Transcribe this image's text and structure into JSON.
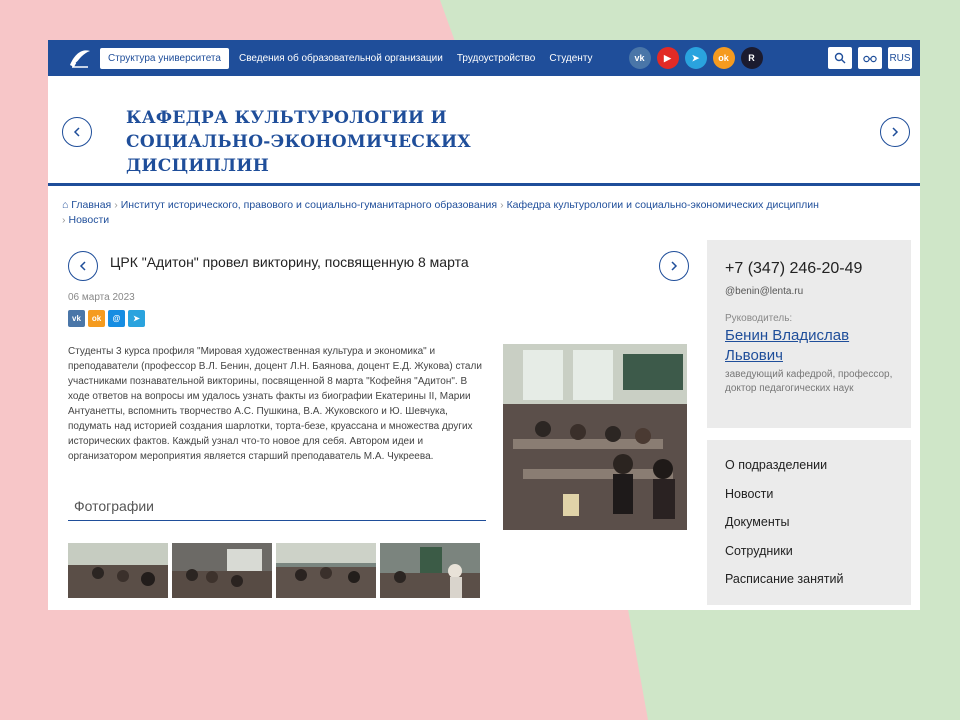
{
  "topbar": {
    "structure_label": "Структура университета",
    "nav": [
      "Сведения об образовательной организации",
      "Трудоустройство",
      "Студенту"
    ],
    "socials": [
      {
        "name": "vk",
        "label": "vk",
        "color": "#4a76a8"
      },
      {
        "name": "youtube",
        "label": "▶",
        "color": "#e22b26"
      },
      {
        "name": "telegram",
        "label": "➤",
        "color": "#2aa3de"
      },
      {
        "name": "odnoklassniki",
        "label": "ok",
        "color": "#f59b1f"
      },
      {
        "name": "rutube",
        "label": "R",
        "color": "#1b1b2f"
      }
    ],
    "lang": "RUS"
  },
  "header": {
    "title": "КАФЕДРА КУЛЬТУРОЛОГИИ И СОЦИАЛЬНО-ЭКОНОМИЧЕСКИХ ДИСЦИПЛИН"
  },
  "breadcrumb": [
    "Главная",
    "Институт исторического, правового и социально-гуманитарного образования",
    "Кафедра культурологии и социально-экономических дисциплин",
    "Новости"
  ],
  "article": {
    "title": "ЦРК \"Адитон\" провел викторину, посвященную 8 марта",
    "date": "06 марта 2023",
    "body": "Студенты 3 курса профиля \"Мировая художественная культура и экономика\" и преподаватели (профессор В.Л. Бенин, доцент Л.Н. Баянова, доцент Е.Д. Жукова) стали участниками познавательной викторины, посвященной 8 марта \"Кофейня \"Адитон\". В ходе ответов на вопросы им удалось узнать факты из биографии Екатерины II, Марии Антуанетты, вспомнить творчество А.С. Пушкина, В.А. Жуковского и Ю. Шевчука, подумать над историей создания шарлотки, торта-безе, круассана и множества других исторических фактов. Каждый узнал что-то новое для себя. Автором идеи и организатором мероприятия является старший преподаватель М.А. Чукреева.",
    "photos_heading": "Фотографии",
    "share": [
      {
        "name": "vk",
        "label": "vk",
        "color": "#4a76a8"
      },
      {
        "name": "odnoklassniki",
        "label": "ok",
        "color": "#f59b1f"
      },
      {
        "name": "mailru",
        "label": "@",
        "color": "#168de2"
      },
      {
        "name": "telegram",
        "label": "➤",
        "color": "#2aa3de"
      }
    ]
  },
  "sidebar": {
    "phone": "+7 (347) 246-20-49",
    "email": "@benin@lenta.ru",
    "head_label": "Руководитель:",
    "head_name": "Бенин Владислав Львович",
    "head_role": "заведующий кафедрой, профессор, доктор педагогических наук",
    "menu": [
      "О подразделении",
      "Новости",
      "Документы",
      "Сотрудники",
      "Расписание занятий"
    ]
  },
  "colors": {
    "brand": "#1f4e9a",
    "sidebar_bg": "#ebebeb"
  }
}
